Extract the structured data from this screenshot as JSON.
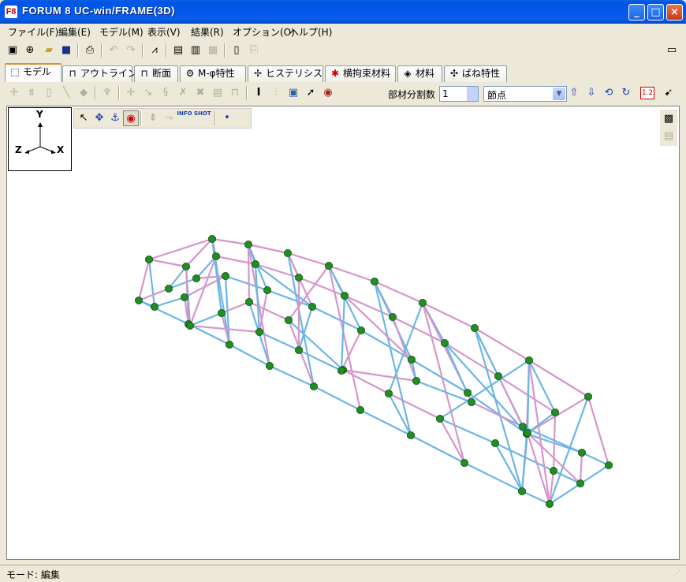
{
  "window": {
    "title": "FORUM 8  UC-win/FRAME(3D)",
    "app_icon": "F8",
    "minimize": "_",
    "maximize": "□",
    "close": "×"
  },
  "menu": [
    "ファイル(F)",
    "編集(E)",
    "モデル(M)",
    "表示(V)",
    "結果(R)",
    "オプション(O)",
    "ヘルプ(H)"
  ],
  "toolbar_icons": [
    "new-model-icon",
    "add-icon",
    "open-folder-icon",
    "save-icon",
    "print-preview-icon",
    "undo-icon",
    "redo-icon",
    "graph-icon",
    "report-icon",
    "report-settings-icon",
    "report-copy-icon",
    "calculator-icon",
    "export-icon",
    "window-mode-icon"
  ],
  "tabs": [
    {
      "label": "モデル",
      "icon": "model-icon",
      "active": true
    },
    {
      "label": "アウトライン",
      "icon": "outline-icon",
      "active": false
    },
    {
      "label": "断面",
      "icon": "section-icon",
      "active": false
    },
    {
      "label": "M-φ特性",
      "icon": "m-phi-icon",
      "active": false
    },
    {
      "label": "ヒステリシス",
      "icon": "hysteresis-icon",
      "active": false
    },
    {
      "label": "横拘束材料",
      "icon": "confinement-icon",
      "active": false
    },
    {
      "label": "材料",
      "icon": "material-icon",
      "active": false
    },
    {
      "label": "ばね特性",
      "icon": "spring-icon",
      "active": false
    }
  ],
  "model_bar": {
    "division_label": "部材分割数",
    "division_value": "1",
    "select_value": "節点",
    "zoom_label": "1.2"
  },
  "axes": {
    "y": "Y",
    "z": "Z",
    "x": "X"
  },
  "float_tools": {
    "info": "INFO",
    "shot": "SHOT"
  },
  "status": {
    "mode": "モード: 編集"
  },
  "colors": {
    "member_blue": "#6ab6e6",
    "member_pink": "#d696cc",
    "node_green": "#1f8f1f",
    "node_outline": "#0a4a0a"
  }
}
